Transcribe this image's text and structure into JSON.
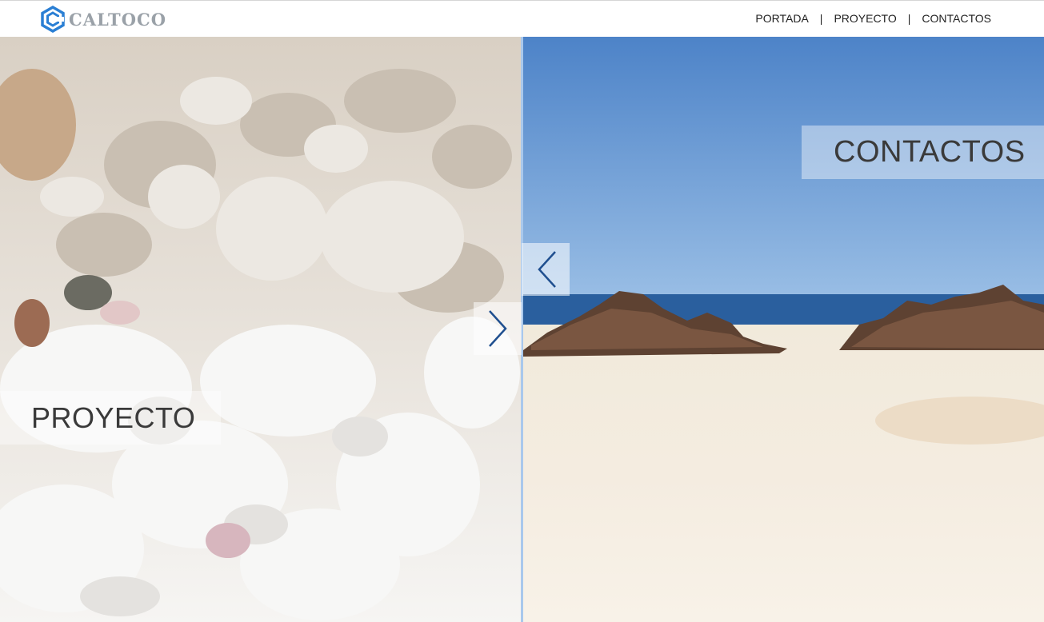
{
  "brand": {
    "name": "CALTOCO",
    "logo_color": "#2a7fd4",
    "text_color": "#9aa1a8"
  },
  "nav": {
    "items": [
      {
        "label": "PORTADA"
      },
      {
        "label": "PROYECTO"
      },
      {
        "label": "CONTACTOS"
      }
    ],
    "separator": "|"
  },
  "panels": {
    "left": {
      "label": "PROYECTO",
      "image": "closeup of white seashell fragments and coral rubble"
    },
    "right": {
      "label": "CONTACTOS",
      "image": "white sand beach with dark rocky outcrops, blue sea and sky"
    }
  },
  "controls": {
    "prev_icon": "chevron-left-icon",
    "next_icon": "chevron-right-icon",
    "arrow_color": "#1f4f8f"
  },
  "colors": {
    "divider": "#a9c8ec",
    "sky": "#5b8fd0",
    "sea": "#2a5f9e",
    "sand": "#f3ecdd"
  }
}
